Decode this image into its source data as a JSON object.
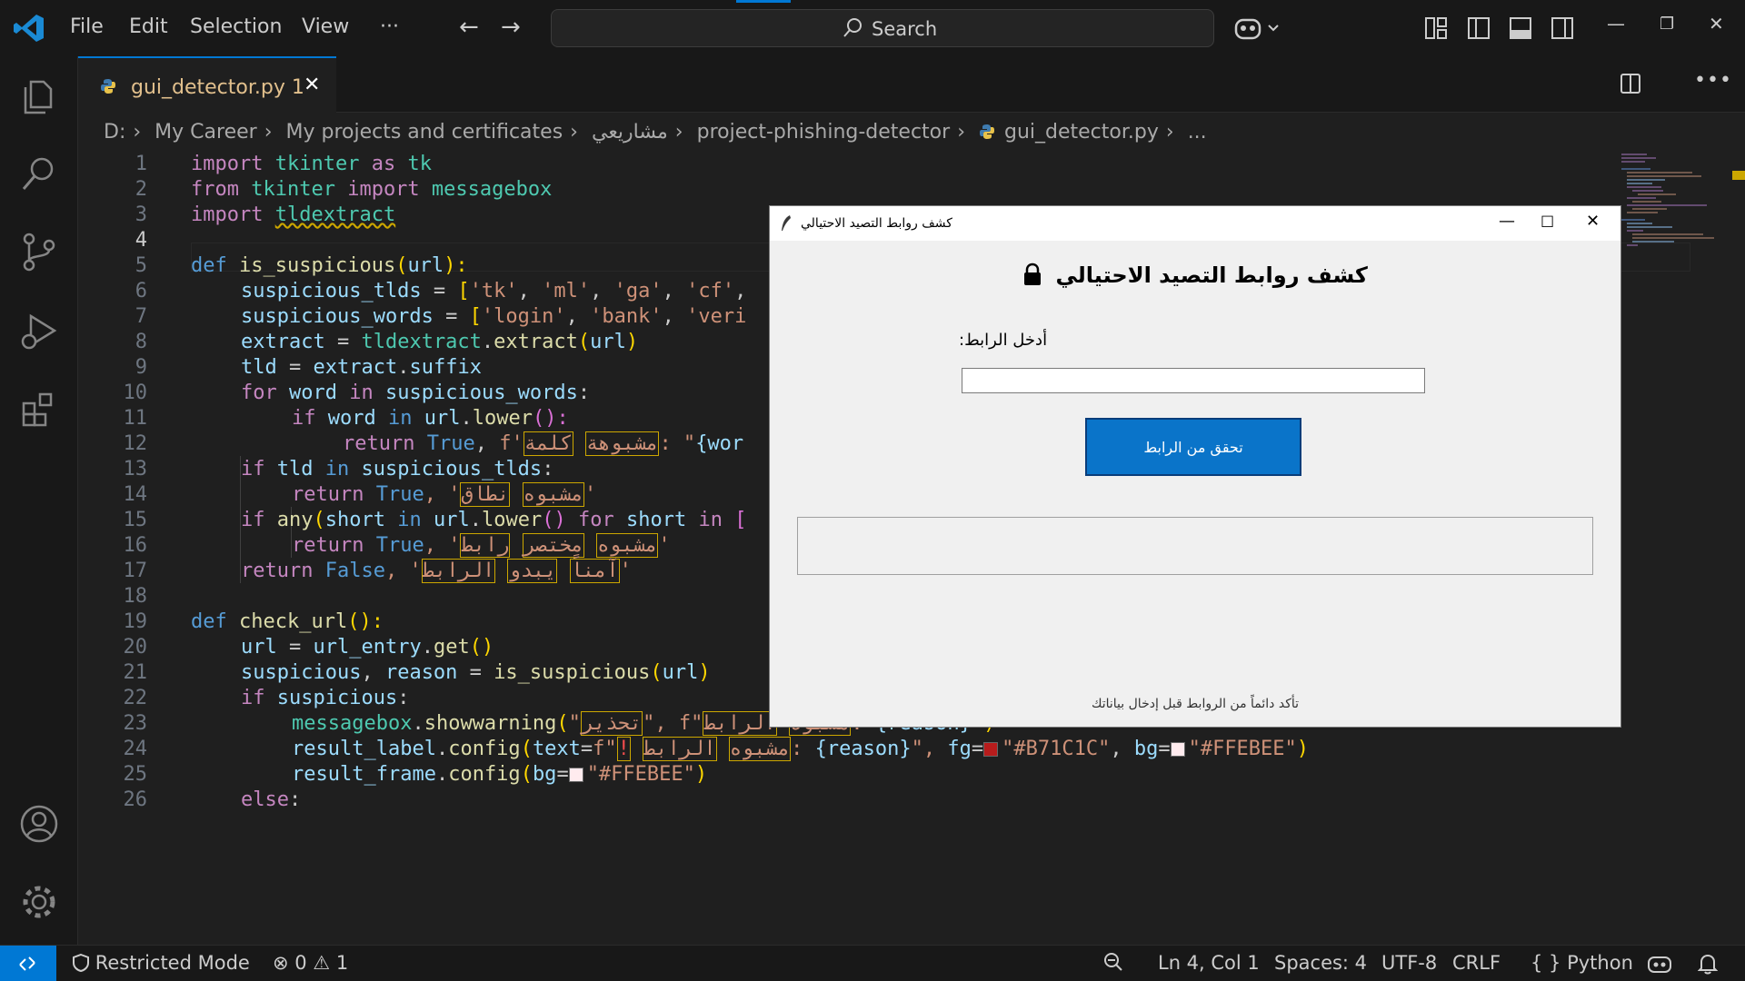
{
  "menu": {
    "file": "File",
    "edit": "Edit",
    "selection": "Selection",
    "view": "View",
    "more": "···"
  },
  "search": {
    "label": "Search"
  },
  "tab": {
    "filename": "gui_detector.py",
    "problems": "1",
    "close": "✕"
  },
  "breadcrumb": [
    "D:",
    "My Career",
    "My projects and certificates",
    "مشاريعي",
    "project-phishing-detector",
    "gui_detector.py",
    "..."
  ],
  "editor": {
    "line_numbers": [
      "1",
      "2",
      "3",
      "4",
      "5",
      "6",
      "7",
      "8",
      "9",
      "10",
      "11",
      "12",
      "13",
      "14",
      "15",
      "16",
      "17",
      "18",
      "19",
      "20",
      "21",
      "22",
      "23",
      "24",
      "25",
      "26"
    ],
    "active_line": "4",
    "code": {
      "l1": {
        "a": "import",
        "b": " tkinter ",
        "c": "as",
        "d": " tk"
      },
      "l2": {
        "a": "from",
        "b": " tkinter ",
        "c": "import",
        "d": " messagebox"
      },
      "l3": {
        "a": "import",
        "b": " ",
        "c": "tldextract"
      },
      "l5": {
        "a": "def",
        "b": " ",
        "c": "is_suspicious",
        "d": "(",
        "e": "url",
        "f": "):"
      },
      "l6": {
        "a": "suspicious_tlds",
        "b": " = ",
        "c": "[",
        "d": "'tk'",
        "e": ", ",
        "f": "'ml'",
        "g": ", ",
        "h": "'ga'",
        "i": ", ",
        "j": "'cf'",
        "k": ","
      },
      "l7": {
        "a": "suspicious_words",
        "b": " = ",
        "c": "[",
        "d": "'login'",
        "e": ", ",
        "f": "'bank'",
        "g": ", ",
        "h": "'veri"
      },
      "l8": {
        "a": "extract",
        "b": " = ",
        "c": "tldextract",
        "d": ".",
        "e": "extract",
        "f": "(",
        "g": "url",
        "h": ")"
      },
      "l9": {
        "a": "tld",
        "b": " = ",
        "c": "extract",
        "d": ".",
        "e": "suffix"
      },
      "l10": {
        "a": "for",
        "b": " ",
        "c": "word",
        "d": " ",
        "e": "in",
        "f": " ",
        "g": "suspicious_words",
        "h": ":"
      },
      "l11": {
        "a": "if",
        "b": " ",
        "c": "word",
        "d": " ",
        "e": "in",
        "f": " ",
        "g": "url",
        "h": ".",
        "i": "lower",
        "j": "():"
      },
      "l12": {
        "a": "return",
        "b": " ",
        "c": "True",
        "d": ", ",
        "e": "f'",
        "f": "مشبوهة",
        "g": " ",
        "h": "كلمة",
        "i": ": \"",
        "j": "{wor"
      },
      "l13": {
        "a": "if",
        "b": " ",
        "c": "tld",
        "d": " ",
        "e": "in",
        "f": " ",
        "g": "suspicious_tlds",
        "h": ":"
      },
      "l14": {
        "a": "return",
        "b": " ",
        "c": "True",
        "d": ", '",
        "e": "مشبوه",
        "f": " ",
        "g": "نطاق",
        "h": "'"
      },
      "l15": {
        "a": "if",
        "b": " ",
        "c": "any",
        "d": "(",
        "e": "short",
        "f": " ",
        "g": "in",
        "h": " ",
        "i": "url",
        "j": ".",
        "k": "lower",
        "l": "() ",
        "m": "for",
        "n": " ",
        "o": "short",
        "p": " ",
        "q": "in",
        "r": " ["
      },
      "l16": {
        "a": "return",
        "b": " ",
        "c": "True",
        "d": ", '",
        "e": "مشبوه",
        "f": " ",
        "g": "مختصر",
        "h": " ",
        "i": "رابط",
        "j": "'"
      },
      "l17": {
        "a": "return",
        "b": " ",
        "c": "False",
        "d": ", '",
        "e": "آمناً",
        "f": " ",
        "g": "يبدو",
        "h": " ",
        "i": "الرابط",
        "j": "'"
      },
      "l19": {
        "a": "def",
        "b": " ",
        "c": "check_url",
        "d": "():"
      },
      "l20": {
        "a": "url",
        "b": " = ",
        "c": "url_entry",
        "d": ".",
        "e": "get",
        "f": "()"
      },
      "l21": {
        "a": "suspicious",
        "b": ", ",
        "c": "reason",
        "d": " = ",
        "e": "is_suspicious",
        "f": "(",
        "g": "url",
        "h": ")"
      },
      "l22": {
        "a": "if",
        "b": " ",
        "c": "suspicious",
        "d": ":"
      },
      "l23": {
        "a": "messagebox",
        "b": ".",
        "c": "showwarning",
        "d": "(",
        "e": "\"",
        "f": "تحذير",
        "g": "\", ",
        "h": "f\"",
        "i": "مشبوه",
        "j": " ",
        "k": "الرابط",
        "l": ": ",
        "m": "{reason}",
        "n": "\"",
        "o": ")"
      },
      "l24": {
        "a": "result_label",
        "b": ".",
        "c": "config",
        "d": "(",
        "e": "text",
        "f": "=",
        "g": "f\"",
        "h": "!",
        "i": " ",
        "j": "مشبوه",
        "k": " ",
        "l": "الرابط",
        "m": ": ",
        "n": "{reason}",
        "o": "\", ",
        "p": "fg",
        "q": "=",
        "r": "\"#B71C1C\"",
        "s": ", ",
        "t": "bg",
        "u": "=",
        "v": "\"#FFEBEE\"",
        "w": ")"
      },
      "l25": {
        "a": "result_frame",
        "b": ".",
        "c": "config",
        "d": "(",
        "e": "bg",
        "f": "=",
        "g": "\"#FFEBEE\"",
        "h": ")"
      },
      "l26": {
        "a": "else",
        "b": ":"
      }
    },
    "swatches": {
      "fg": "#B71C1C",
      "bg": "#FFEBEE"
    }
  },
  "tk_window": {
    "title": "كشف روابط التصيد الاحتيالي",
    "heading": "كشف روابط التصيد الاحتيالي",
    "entry_label": "أدخل الرابط:",
    "entry_value": "",
    "button_label": "تحقق من الرابط",
    "footer": "تأكد دائماً من الروابط قبل إدخال بياناتك",
    "button_color": "#0a74c9"
  },
  "statusbar": {
    "restricted": "Restricted Mode",
    "errors": "0",
    "warnings": "1",
    "position": "Ln 4, Col 1",
    "spaces": "Spaces: 4",
    "encoding": "UTF-8",
    "eol": "CRLF",
    "language": "Python"
  },
  "colors": {
    "accent": "#0078d4",
    "tab_modified": "#e2c08d",
    "warning": "#cca700"
  }
}
